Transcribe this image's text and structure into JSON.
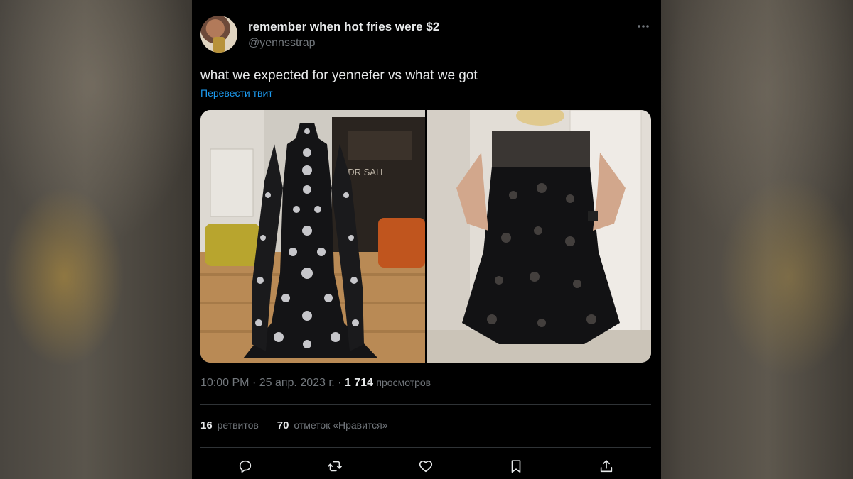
{
  "tweet": {
    "author_name": "remember when hot fries were $2",
    "author_handle": "@yennsstrap",
    "text": "what we expected for yennefer vs what we got",
    "translate_label": "Перевести твит",
    "time": "10:00 PM",
    "separator": "·",
    "date": "25 апр. 2023 г.",
    "views_count": "1 714",
    "views_label": "просмотров",
    "retweets_count": "16",
    "retweets_label": "ретвитов",
    "likes_count": "70",
    "likes_label": "отметок «Нравится»"
  },
  "icons": {
    "more": "more-dots-icon",
    "reply": "reply-icon",
    "retweet": "retweet-icon",
    "like": "heart-icon",
    "bookmark": "bookmark-icon",
    "share": "share-icon"
  },
  "colors": {
    "background": "#000000",
    "text": "#e7e9ea",
    "secondary": "#71767b",
    "link": "#1d9bf0",
    "divider": "#2f3336"
  }
}
